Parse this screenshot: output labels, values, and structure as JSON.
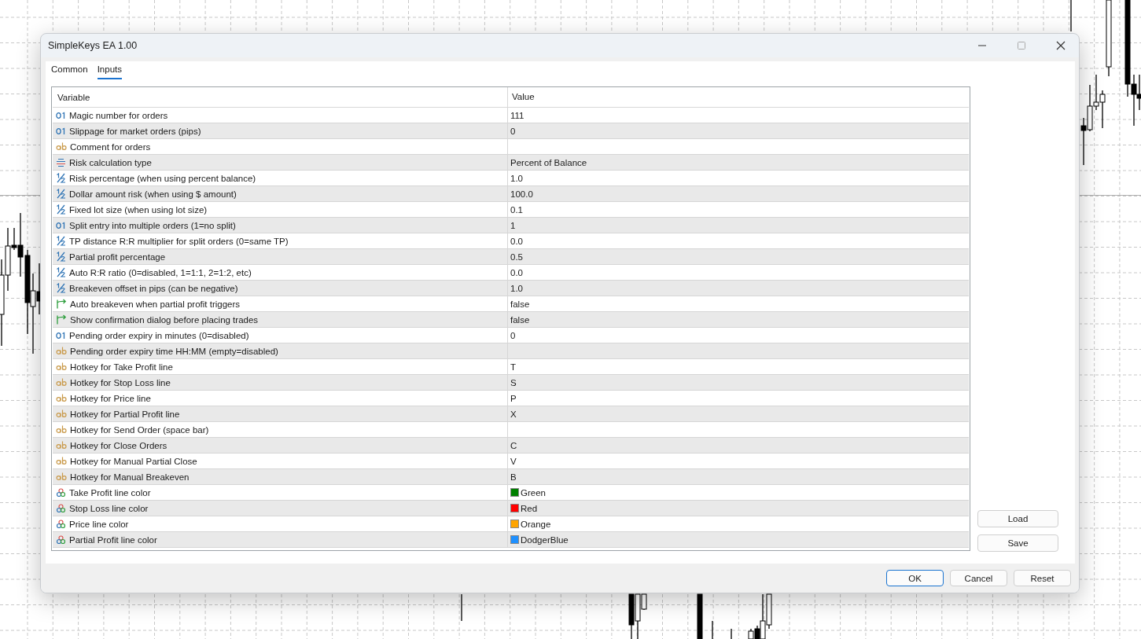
{
  "window": {
    "title": "SimpleKeys EA 1.00"
  },
  "tabs": [
    {
      "label": "Common",
      "selected": false
    },
    {
      "label": "Inputs",
      "selected": true
    }
  ],
  "table": {
    "columns": [
      "Variable",
      "Value"
    ],
    "rows": [
      {
        "kind": "int",
        "variable": "Magic number for orders",
        "value": "111"
      },
      {
        "kind": "int",
        "variable": "Slippage for market orders (pips)",
        "value": "0"
      },
      {
        "kind": "string",
        "variable": "Comment for orders"
      },
      {
        "kind": "enum",
        "variable": "Risk calculation type",
        "value": "Percent of Balance"
      },
      {
        "kind": "double",
        "variable": "Risk percentage (when using percent balance)",
        "value": "1.0"
      },
      {
        "kind": "double",
        "variable": "Dollar amount risk (when using $ amount)",
        "value": "100.0"
      },
      {
        "kind": "double",
        "variable": "Fixed lot size (when using lot size)",
        "value": "0.1"
      },
      {
        "kind": "int",
        "variable": "Split entry into multiple orders (1=no split)",
        "value": "1"
      },
      {
        "kind": "double",
        "variable": "TP distance R:R multiplier for split orders (0=same TP)",
        "value": "0.0"
      },
      {
        "kind": "double",
        "variable": "Partial profit percentage",
        "value": "0.5"
      },
      {
        "kind": "double",
        "variable": "Auto R:R ratio (0=disabled, 1=1:1, 2=1:2, etc)",
        "value": "0.0"
      },
      {
        "kind": "double",
        "variable": "Breakeven offset in pips (can be negative)",
        "value": "1.0"
      },
      {
        "kind": "bool",
        "variable": "Auto breakeven when partial profit triggers",
        "value": "false"
      },
      {
        "kind": "bool",
        "variable": "Show confirmation dialog before placing trades",
        "value": "false"
      },
      {
        "kind": "int",
        "variable": "Pending order expiry in minutes (0=disabled)",
        "value": "0"
      },
      {
        "kind": "string",
        "variable": "Pending order expiry time HH:MM (empty=disabled)"
      },
      {
        "kind": "string",
        "variable": "Hotkey for Take Profit line",
        "value": "T"
      },
      {
        "kind": "string",
        "variable": "Hotkey for Stop Loss line",
        "value": "S"
      },
      {
        "kind": "string",
        "variable": "Hotkey for Price line",
        "value": "P"
      },
      {
        "kind": "string",
        "variable": "Hotkey for Partial Profit line",
        "value": "X"
      },
      {
        "kind": "string",
        "variable": "Hotkey for Send Order (space bar)"
      },
      {
        "kind": "string",
        "variable": "Hotkey for Close Orders",
        "value": "C"
      },
      {
        "kind": "string",
        "variable": "Hotkey for Manual Partial Close",
        "value": "V"
      },
      {
        "kind": "string",
        "variable": "Hotkey for Manual Breakeven",
        "value": "B"
      },
      {
        "kind": "color",
        "variable": "Take Profit line color",
        "value": "Green",
        "color": "#008000"
      },
      {
        "kind": "color",
        "variable": "Stop Loss line color",
        "value": "Red",
        "color": "#ff0000"
      },
      {
        "kind": "color",
        "variable": "Price line color",
        "value": "Orange",
        "color": "#ffa500"
      },
      {
        "kind": "color",
        "variable": "Partial Profit line color",
        "value": "DodgerBlue",
        "color": "#1e90ff"
      }
    ]
  },
  "side_buttons": [
    "Load",
    "Save"
  ],
  "buttons": [
    {
      "label": "OK",
      "default": true
    },
    {
      "label": "Cancel",
      "default": false
    },
    {
      "label": "Reset",
      "default": false
    }
  ]
}
